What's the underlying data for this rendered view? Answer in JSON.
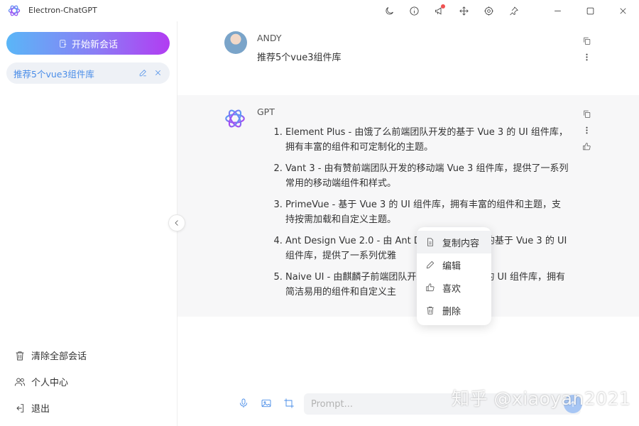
{
  "app": {
    "title": "Electron-ChatGPT"
  },
  "titlebar_icons": [
    "moon-icon",
    "info-icon",
    "megaphone-icon",
    "move-icon",
    "gear-icon",
    "pin-icon",
    "minimize-icon",
    "maximize-icon",
    "close-icon"
  ],
  "sidebar": {
    "new_chat_label": "开始新会话",
    "conversations": [
      {
        "title": "推荐5个vue3组件库"
      }
    ],
    "menu": [
      {
        "label": "清除全部会话",
        "icon": "trash-icon"
      },
      {
        "label": "个人中心",
        "icon": "users-icon"
      },
      {
        "label": "退出",
        "icon": "logout-icon"
      }
    ]
  },
  "messages": {
    "user": {
      "sender": "ANDY",
      "text": "推荐5个vue3组件库"
    },
    "gpt": {
      "sender": "GPT",
      "items": [
        "Element Plus - 由饿了么前端团队开发的基于 Vue 3 的 UI 组件库，拥有丰富的组件和可定制化的主题。",
        "Vant 3 - 由有赞前端团队开发的移动端 Vue 3 组件库，提供了一系列常用的移动端组件和样式。",
        "PrimeVue - 基于 Vue 3 的 UI 组件库，拥有丰富的组件和主题，支持按需加载和自定义主题。",
        "Ant Design Vue 2.0 - 由 Ant Design 团队开发的基于 Vue 3 的 UI 组件库，提供了一系列优雅",
        "Naive UI - 由麒麟子前端团队开发的基于 Vue 3 的 UI 组件库，拥有简洁易用的组件和自定义主"
      ]
    }
  },
  "context_menu": {
    "items": [
      {
        "label": "复制内容",
        "icon": "document-icon"
      },
      {
        "label": "编辑",
        "icon": "pencil-icon"
      },
      {
        "label": "喜欢",
        "icon": "thumbs-up-icon"
      },
      {
        "label": "删除",
        "icon": "trash-icon"
      }
    ]
  },
  "input": {
    "placeholder": "Prompt...",
    "value": ""
  },
  "watermark": "知乎 @xiaoyan2021",
  "colors": {
    "accent": "#4a8de8",
    "gradient_start": "#5ab6f7",
    "gradient_end": "#b23cf2",
    "notification_dot": "#f05252"
  }
}
